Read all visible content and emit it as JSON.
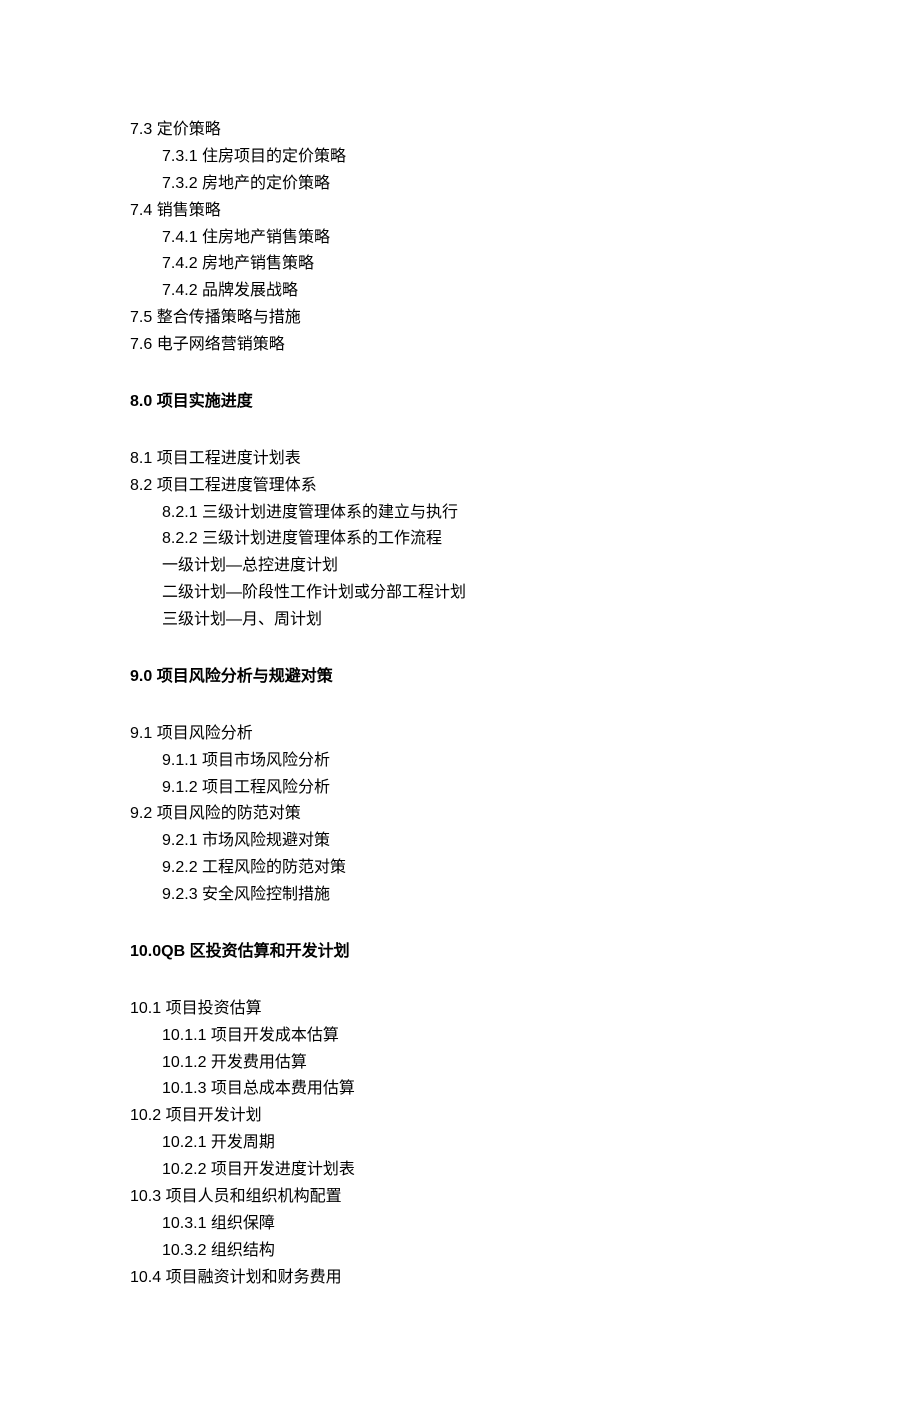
{
  "sections": [
    {
      "items": [
        {
          "level": 1,
          "text": "7.3 定价策略"
        },
        {
          "level": 2,
          "text": "7.3.1 住房项目的定价策略"
        },
        {
          "level": 2,
          "text": "7.3.2 房地产的定价策略"
        },
        {
          "level": 1,
          "text": "7.4 销售策略"
        },
        {
          "level": 2,
          "text": "7.4.1 住房地产销售策略"
        },
        {
          "level": 2,
          "text": "7.4.2 房地产销售策略"
        },
        {
          "level": 2,
          "text": "7.4.2 品牌发展战略"
        },
        {
          "level": 1,
          "text": "7.5 整合传播策略与措施"
        },
        {
          "level": 1,
          "text": "7.6 电子网络营销策略"
        }
      ]
    },
    {
      "heading": "8.0 项目实施进度",
      "items": [
        {
          "level": 1,
          "text": "8.1 项目工程进度计划表"
        },
        {
          "level": 1,
          "text": "8.2 项目工程进度管理体系"
        },
        {
          "level": 2,
          "text": "8.2.1 三级计划进度管理体系的建立与执行"
        },
        {
          "level": 2,
          "text": "8.2.2 三级计划进度管理体系的工作流程"
        },
        {
          "level": 2,
          "text": "一级计划—总控进度计划"
        },
        {
          "level": 2,
          "text": "二级计划—阶段性工作计划或分部工程计划"
        },
        {
          "level": 2,
          "text": "三级计划—月、周计划"
        }
      ]
    },
    {
      "heading": "9.0 项目风险分析与规避对策",
      "items": [
        {
          "level": 1,
          "text": "9.1 项目风险分析"
        },
        {
          "level": 2,
          "text": "9.1.1 项目市场风险分析"
        },
        {
          "level": 2,
          "text": "9.1.2 项目工程风险分析"
        },
        {
          "level": 1,
          "text": "9.2 项目风险的防范对策"
        },
        {
          "level": 2,
          "text": "9.2.1 市场风险规避对策"
        },
        {
          "level": 2,
          "text": "9.2.2 工程风险的防范对策"
        },
        {
          "level": 2,
          "text": "9.2.3 安全风险控制措施"
        }
      ]
    },
    {
      "heading": "10.0QB 区投资估算和开发计划",
      "items": [
        {
          "level": 1,
          "text": "10.1 项目投资估算"
        },
        {
          "level": 2,
          "text": "10.1.1 项目开发成本估算"
        },
        {
          "level": 2,
          "text": "10.1.2 开发费用估算"
        },
        {
          "level": 2,
          "text": "10.1.3 项目总成本费用估算"
        },
        {
          "level": 1,
          "text": "10.2 项目开发计划"
        },
        {
          "level": 2,
          "text": "10.2.1 开发周期"
        },
        {
          "level": 2,
          "text": "10.2.2 项目开发进度计划表"
        },
        {
          "level": 1,
          "text": "10.3 项目人员和组织机构配置"
        },
        {
          "level": 2,
          "text": "10.3.1 组织保障"
        },
        {
          "level": 2,
          "text": "10.3.2 组织结构"
        },
        {
          "level": 1,
          "text": "10.4 项目融资计划和财务费用"
        }
      ]
    }
  ]
}
